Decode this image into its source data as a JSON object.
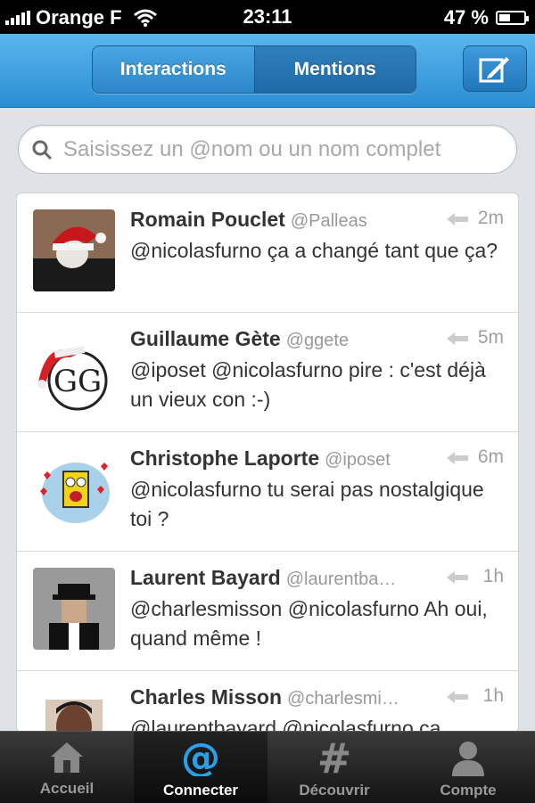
{
  "status_bar": {
    "carrier": "Orange F",
    "time": "23:11",
    "battery": "47 %",
    "battery_level": 0.47
  },
  "nav": {
    "segments": [
      "Interactions",
      "Mentions"
    ],
    "active_segment": "Mentions"
  },
  "search": {
    "placeholder": "Saisissez un @nom ou un nom complet"
  },
  "tweets": [
    {
      "name": "Romain Pouclet",
      "handle": "@Palleas",
      "time": "2m",
      "text": "@nicolasfurno ça a changé tant que ça?"
    },
    {
      "name": "Guillaume Gète",
      "handle": "@ggete",
      "time": "5m",
      "text": "@iposet @nicolasfurno pire : c'est déjà un vieux con :-)"
    },
    {
      "name": "Christophe Laporte",
      "handle": "@iposet",
      "time": "6m",
      "text": "@nicolasfurno tu serai pas nostalgique toi ?"
    },
    {
      "name": "Laurent Bayard",
      "handle": "@laurentba…",
      "time": "1h",
      "text": "@charlesmisson @nicolasfurno Ah oui, quand même !"
    },
    {
      "name": "Charles Misson",
      "handle": "@charlesmi…",
      "time": "1h",
      "text": "@laurentbayard @nicolasfurno ça"
    }
  ],
  "tabs": [
    {
      "label": "Accueil",
      "icon": "home-icon",
      "active": false
    },
    {
      "label": "Connecter",
      "icon": "at-icon",
      "active": true
    },
    {
      "label": "Découvrir",
      "icon": "hash-icon",
      "active": false
    },
    {
      "label": "Compte",
      "icon": "person-icon",
      "active": false
    }
  ],
  "colors": {
    "nav_blue": "#2a8ed3",
    "tab_active": "#2aa0e8"
  }
}
